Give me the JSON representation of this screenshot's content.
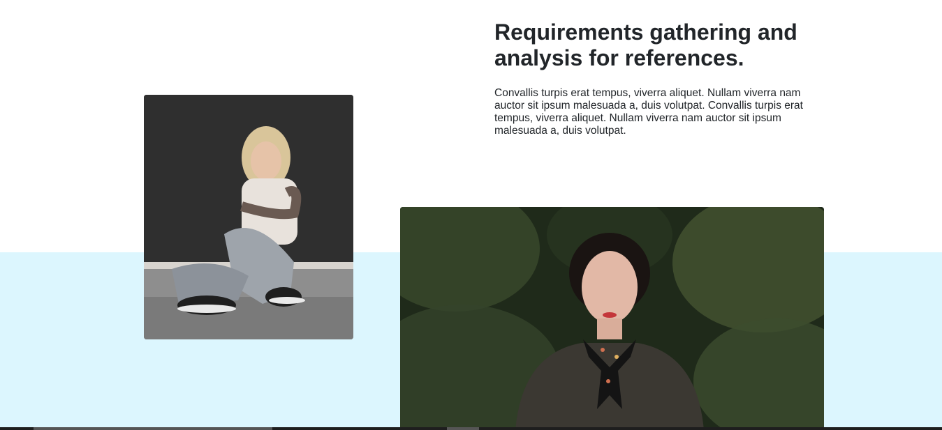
{
  "section": {
    "heading": "Requirements gathering and analysis for references.",
    "body": "Convallis turpis erat tempus, viverra aliquet. Nullam viverra nam auctor sit ipsum malesuada a, duis volutpat. Convallis turpis erat tempus, viverra aliquet. Nullam viverra nam auctor sit ipsum malesuada a, duis volutpat."
  },
  "colors": {
    "band": "#dcf6fe",
    "text": "#212529"
  }
}
